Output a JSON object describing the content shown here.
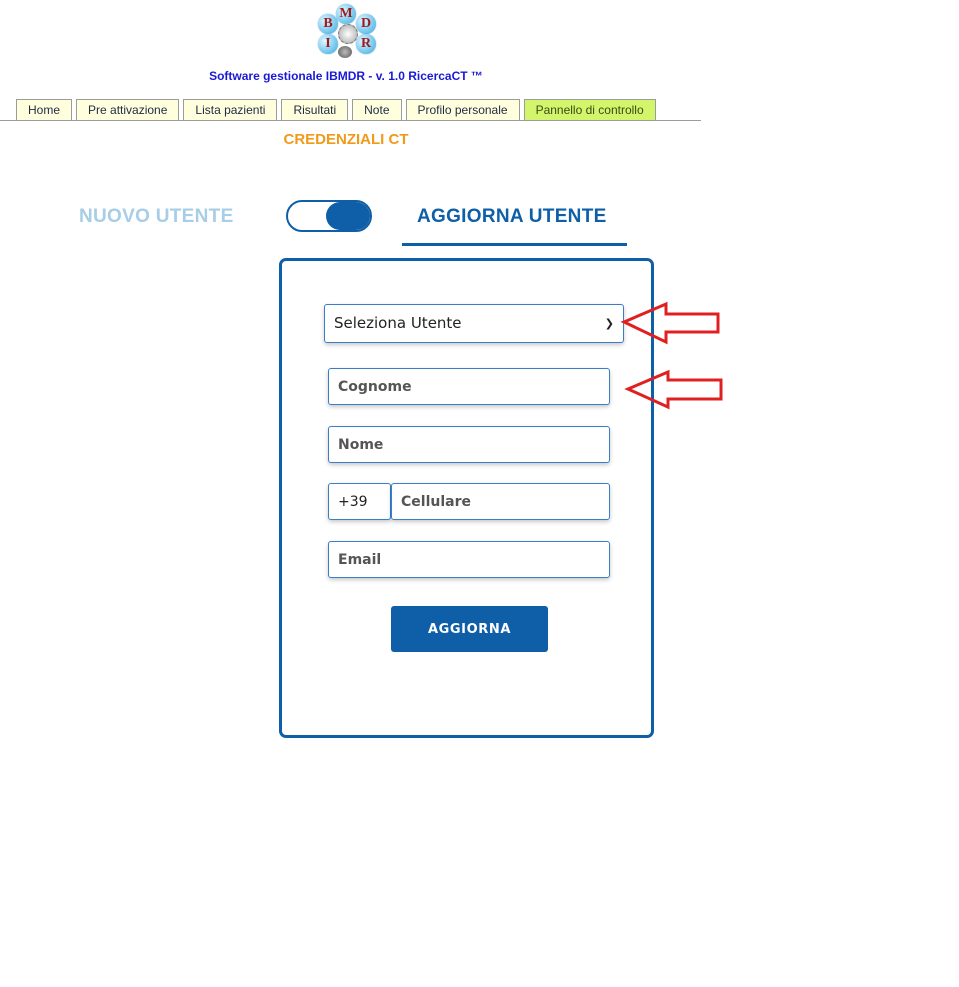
{
  "logo": {
    "letters": [
      "B",
      "M",
      "D",
      "I",
      "R"
    ]
  },
  "header": {
    "app_title": "Software gestionale IBMDR - v. 1.0 RicercaCT ™"
  },
  "nav": {
    "tabs": [
      {
        "label": "Home",
        "active": false
      },
      {
        "label": "Pre attivazione",
        "active": false
      },
      {
        "label": "Lista pazienti",
        "active": false
      },
      {
        "label": "Risultati",
        "active": false
      },
      {
        "label": "Note",
        "active": false
      },
      {
        "label": "Profilo personale",
        "active": false
      },
      {
        "label": "Pannello di controllo",
        "active": true
      }
    ]
  },
  "page": {
    "section_title": "CREDENZIALI CT"
  },
  "mode": {
    "new_user_label": "NUOVO UTENTE",
    "update_user_label": "AGGIORNA UTENTE",
    "selected": "AGGIORNA UTENTE"
  },
  "form": {
    "user_select": {
      "selected": "Seleziona Utente"
    },
    "surname_placeholder": "Cognome",
    "name_placeholder": "Nome",
    "phone_prefix": "+39",
    "mobile_placeholder": "Cellulare",
    "email_placeholder": "Email",
    "submit_label": "AGGIORNA"
  },
  "colors": {
    "primary": "#0e5fa8",
    "accent_orange": "#f09a1a",
    "tab_bg": "#ffffde",
    "tab_active_bg": "#d3f56b",
    "title_blue": "#1a1ad6",
    "annotation_arrow": "#e02020"
  }
}
